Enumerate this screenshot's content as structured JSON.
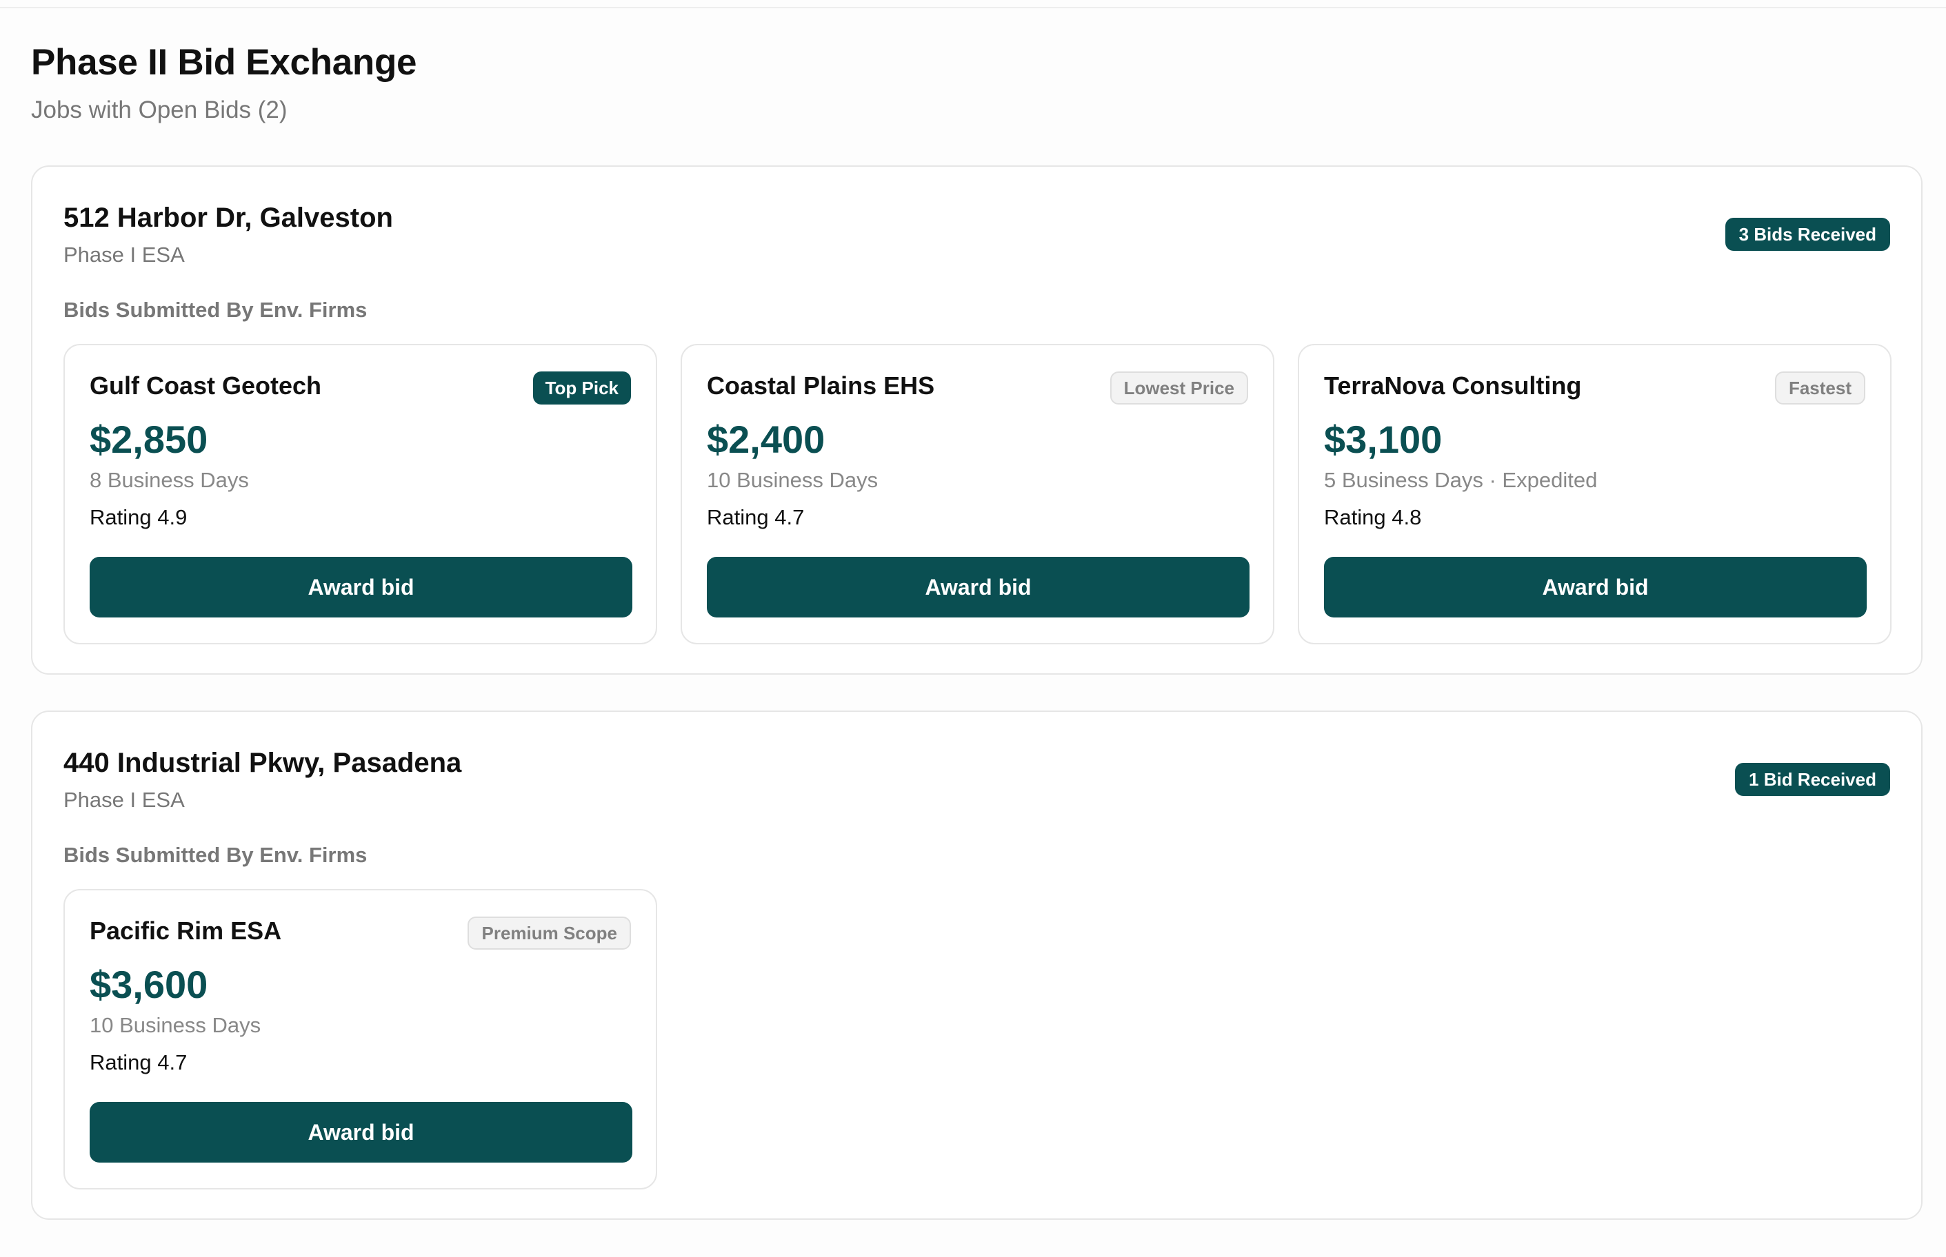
{
  "header": {
    "title": "Phase II Bid Exchange",
    "subtitle": "Jobs with Open Bids (2)"
  },
  "colors": {
    "accent": "#0a4f52",
    "muted_text": "#777777",
    "border": "#e6e6e6"
  },
  "jobs": [
    {
      "address": "512 Harbor Dr, Galveston",
      "type": "Phase I ESA",
      "bids_badge": "3 Bids Received",
      "section_label": "Bids Submitted By Env. Firms",
      "bids": [
        {
          "firm": "Gulf Coast Geotech",
          "tag": "Top Pick",
          "price": "$2,850",
          "timeline": "8 Business Days",
          "rating": "Rating 4.9",
          "action": "Award bid"
        },
        {
          "firm": "Coastal Plains EHS",
          "tag": "Lowest Price",
          "price": "$2,400",
          "timeline": "10 Business Days",
          "rating": "Rating 4.7",
          "action": "Award bid"
        },
        {
          "firm": "TerraNova Consulting",
          "tag": "Fastest",
          "price": "$3,100",
          "timeline": "5 Business Days · Expedited",
          "rating": "Rating 4.8",
          "action": "Award bid"
        }
      ]
    },
    {
      "address": "440 Industrial Pkwy, Pasadena",
      "type": "Phase I ESA",
      "bids_badge": "1 Bid Received",
      "section_label": "Bids Submitted By Env. Firms",
      "bids": [
        {
          "firm": "Pacific Rim ESA",
          "tag": "Premium Scope",
          "price": "$3,600",
          "timeline": "10 Business Days",
          "rating": "Rating 4.7",
          "action": "Award bid"
        }
      ]
    }
  ]
}
